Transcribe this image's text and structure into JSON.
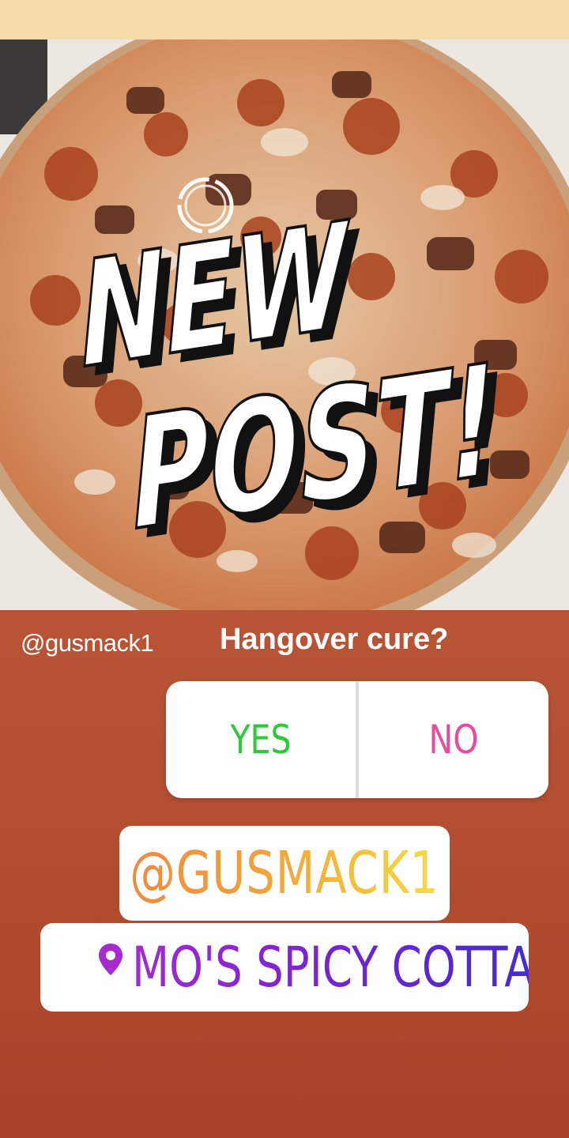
{
  "story": {
    "headline_line1": "NEW",
    "headline_line2": "POST!",
    "author_label": "@gusmack1"
  },
  "poll": {
    "question": "Hangover cure?",
    "options": [
      {
        "label": "YES",
        "color": "#2ec93a"
      },
      {
        "label": "NO",
        "color": "#ec4a9c"
      }
    ]
  },
  "mention_sticker": {
    "text": "@GUSMACK1"
  },
  "location_sticker": {
    "icon": "location-pin-icon",
    "text": "MO'S SPICY COTTAGE"
  },
  "colors": {
    "top_strip": "#f4dca8",
    "background_top": "#c26446",
    "background_bottom": "#a8432a"
  }
}
